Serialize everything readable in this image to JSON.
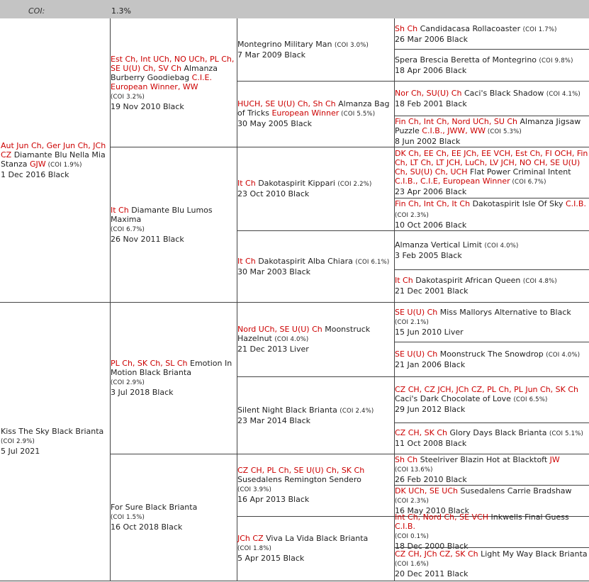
{
  "header": {
    "coi_label": "COI:",
    "coi_value": "1.3%"
  },
  "gen1": [
    {
      "pre": "Aut Jun Ch, Ger Jun Ch, JCh CZ",
      "name": " Diamante Blu Nella Mia Stanza ",
      "title": "GJW",
      "coi": " (COI 1.9%)",
      "date": "1 Dec 2016 Black"
    },
    {
      "pre": "",
      "name": "Kiss The Sky Black Brianta",
      "title": "",
      "coi": "(COI 2.9%)",
      "date": "5 Jul 2021"
    }
  ],
  "gen2": [
    {
      "pre": "Est Ch, Int UCh, NO UCh, PL Ch, SE U(U) Ch, SV Ch",
      "name": " Almanza Burberry Goodiebag ",
      "title": "C.I.E. European Winner, WW",
      "coi": "(COI 3.2%)",
      "date": "19 Nov 2010 Black"
    },
    {
      "pre": "It Ch",
      "name": " Diamante Blu Lumos Maxima ",
      "title": "",
      "coi": "(COI 6.7%)",
      "date": "26 Nov 2011 Black"
    },
    {
      "pre": "PL Ch, SK Ch, SL Ch",
      "name": " Emotion In Motion Black Brianta ",
      "title": "",
      "coi": "(COI 2.9%)",
      "date": "3 Jul 2018 Black"
    },
    {
      "pre": "",
      "name": "For Sure Black Brianta",
      "title": "",
      "coi": "(COI 1.5%)",
      "date": "16 Oct 2018 Black"
    }
  ],
  "gen3": [
    {
      "pre": "",
      "name": "Montegrino Military Man ",
      "title": "",
      "coi": "(COI 3.0%)",
      "date": "7 Mar 2009 Black"
    },
    {
      "pre": "HUCH, SE U(U) Ch, Sh Ch",
      "name": " Almanza Bag of Tricks ",
      "title": "European Winner",
      "coi": " (COI 5.5%)",
      "date": "30 May 2005 Black"
    },
    {
      "pre": "It Ch",
      "name": " Dakotaspirit Kippari ",
      "title": "",
      "coi": "(COI 2.2%)",
      "date": "23 Oct 2010 Black"
    },
    {
      "pre": "It Ch",
      "name": " Dakotaspirit Alba Chiara ",
      "title": "",
      "coi": "(COI 6.1%)",
      "date": "30 Mar 2003 Black"
    },
    {
      "pre": "Nord UCh, SE U(U) Ch",
      "name": " Moonstruck Hazelnut ",
      "title": "",
      "coi": "(COI 4.0%)",
      "date": "21 Dec 2013 Liver"
    },
    {
      "pre": "",
      "name": "Silent Night Black Brianta ",
      "title": "",
      "coi": "(COI 2.4%)",
      "date": "23 Mar 2014 Black"
    },
    {
      "pre": "CZ CH, PL Ch, SE U(U) Ch, SK Ch",
      "name": " Susedalens Remington Sendero ",
      "title": "",
      "coi": "(COI 3.9%)",
      "date": "16 Apr 2013 Black"
    },
    {
      "pre": "JCh CZ",
      "name": " Viva La Vida Black Brianta ",
      "title": "",
      "coi": "(COI 1.8%)",
      "date": "5 Apr 2015 Black"
    }
  ],
  "gen4": [
    {
      "pre": "Sh Ch",
      "name": " Candidacasa Rollacoaster ",
      "title": "",
      "coi": "(COI 1.7%)",
      "date": "26 Mar 2006 Black"
    },
    {
      "pre": "",
      "name": "Spera Brescia Beretta of Montegrino ",
      "title": "",
      "coi": "(COI 9.8%)",
      "date": "18 Apr 2006 Black"
    },
    {
      "pre": "Nor Ch, SU(U) Ch",
      "name": " Caci's Black Shadow ",
      "title": "",
      "coi": "(COI 4.1%)",
      "date": "18 Feb 2001 Black"
    },
    {
      "pre": "Fin Ch, Int Ch, Nord UCh, SU Ch",
      "name": " Almanza Jigsaw Puzzle ",
      "title": "C.I.B., JWW, WW",
      "coi": " (COI 5.3%)",
      "date": "8 Jun 2002 Black"
    },
    {
      "pre": "DK Ch, EE Ch, EE JCh, EE VCH, Est Ch, FI OCH, Fin Ch, LT Ch, LT JCH, LuCh, LV JCH, NO CH, SE U(U) Ch, SU(U) Ch, UCH",
      "name": " Flat Power Criminal Intent ",
      "title": "C.I.B., C.I.E, European Winner",
      "coi": " (COI 6.7%)",
      "date": "23 Apr 2006 Black"
    },
    {
      "pre": "Fin Ch, Int Ch, It Ch",
      "name": " Dakotaspirit Isle Of Sky ",
      "title": "C.I.B.",
      "coi": " (COI 2.3%)",
      "date": "10 Oct 2006 Black"
    },
    {
      "pre": "",
      "name": "Almanza Vertical Limit ",
      "title": "",
      "coi": "(COI 4.0%)",
      "date": "3 Feb 2005 Black"
    },
    {
      "pre": "It Ch",
      "name": " Dakotaspirit African Queen ",
      "title": "",
      "coi": "(COI 4.8%)",
      "date": "21 Dec 2001 Black"
    },
    {
      "pre": "SE U(U) Ch",
      "name": " Miss Mallorys Alternative to Black ",
      "title": "",
      "coi": "(COI 2.1%)",
      "date": "15 Jun 2010 Liver"
    },
    {
      "pre": "SE U(U) Ch",
      "name": " Moonstruck The Snowdrop ",
      "title": "",
      "coi": "(COI 4.0%)",
      "date": "21 Jan 2006 Black"
    },
    {
      "pre": "CZ CH, CZ JCH, JCh CZ, PL Ch, PL Jun Ch, SK Ch",
      "name": " Caci's Dark Chocolate of Love ",
      "title": "",
      "coi": "(COI 6.5%)",
      "date": "29 Jun 2012 Black"
    },
    {
      "pre": "CZ CH, SK Ch",
      "name": " Glory Days Black Brianta ",
      "title": "",
      "coi": "(COI 5.1%)",
      "date": "11 Oct 2008 Black"
    },
    {
      "pre": "Sh Ch",
      "name": " Steelriver Blazin Hot at Blacktoft ",
      "title": "JW",
      "coi": "(COI 13.6%)",
      "date": "26 Feb 2010 Black"
    },
    {
      "pre": "DK UCh, SE UCh",
      "name": " Susedalens Carrie Bradshaw ",
      "title": "",
      "coi": "(COI 2.3%)",
      "date": "16 May 2010 Black"
    },
    {
      "pre": "Int Ch, Nord Ch, SE VCH",
      "name": " Inkwells Final Guess ",
      "title": "C.I.B.",
      "coi": " (COI 0.1%)",
      "date": "18 Dec 2000 Black"
    },
    {
      "pre": "CZ CH, JCh CZ, SK Ch",
      "name": " Light My Way Black Brianta ",
      "title": "",
      "coi": "(COI 1.6%)",
      "date": "20 Dec 2011 Black"
    }
  ]
}
